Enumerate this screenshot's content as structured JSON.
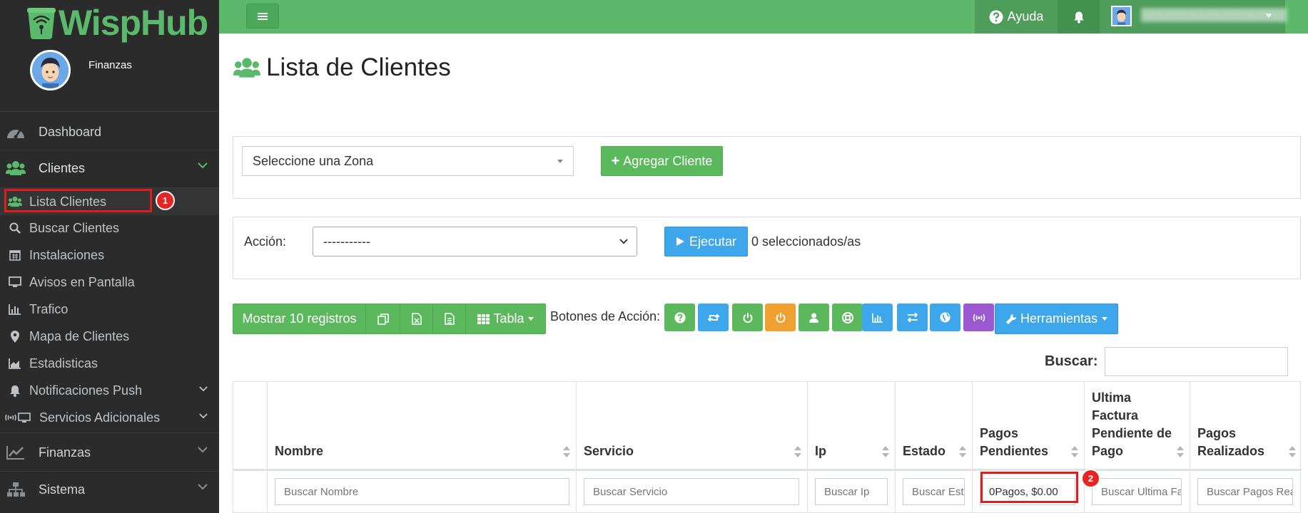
{
  "brand": {
    "name": "WispHub"
  },
  "user": {
    "role": "Finanzas"
  },
  "sidebar": {
    "main_items": [
      {
        "label": "Dashboard"
      },
      {
        "label": "Clientes"
      },
      {
        "label": "Finanzas"
      },
      {
        "label": "Sistema"
      }
    ],
    "clientes_sub": [
      {
        "label": "Lista Clientes"
      },
      {
        "label": "Buscar Clientes"
      },
      {
        "label": "Instalaciones"
      },
      {
        "label": "Avisos en Pantalla"
      },
      {
        "label": "Trafico"
      },
      {
        "label": "Mapa de Clientes"
      },
      {
        "label": "Estadisticas"
      },
      {
        "label": "Notificaciones Push"
      },
      {
        "label": "Servicios Adicionales"
      }
    ]
  },
  "annotations": {
    "marker1": "1",
    "marker2": "2"
  },
  "topbar": {
    "help_label": "Ayuda"
  },
  "page": {
    "title": "Lista de Clientes"
  },
  "zona": {
    "selected": "Seleccione una Zona"
  },
  "add_client": {
    "label": "Agregar Cliente"
  },
  "accion": {
    "label": "Acción:",
    "selected": "-----------",
    "execute_label": "Ejecutar",
    "selected_count": "0 seleccionados/as"
  },
  "toolbar": {
    "show_records": "Mostrar 10 registros",
    "view_label": "Tabla",
    "action_buttons_label": "Botones de Acción:",
    "tools_label": "Herramientas",
    "action_colors": [
      "#5cb85c",
      "#3ea6ea",
      "#5cb85c",
      "#f0a030",
      "#5cb85c",
      "#5cb85c",
      "#3ea6ea",
      "#3ea6ea",
      "#3ea6ea",
      "#9b59d0"
    ]
  },
  "search": {
    "label": "Buscar:"
  },
  "table": {
    "columns": [
      {
        "label": ""
      },
      {
        "label": "Nombre"
      },
      {
        "label": "Servicio"
      },
      {
        "label": "Ip"
      },
      {
        "label": "Estado"
      },
      {
        "label": "Pagos Pendientes"
      },
      {
        "label": "Ultima Factura Pendiente de Pago"
      },
      {
        "label": "Pagos Realizados"
      }
    ],
    "filters": [
      {
        "placeholder": "Buscar Nombre",
        "value": ""
      },
      {
        "placeholder": "Buscar Servicio",
        "value": ""
      },
      {
        "placeholder": "Buscar Ip",
        "value": ""
      },
      {
        "placeholder": "Buscar Estado",
        "value": ""
      },
      {
        "placeholder": "",
        "value": "0Pagos, $0.00"
      },
      {
        "placeholder": "Buscar Ultima Factura",
        "value": ""
      },
      {
        "placeholder": "Buscar Pagos Realizados",
        "value": ""
      }
    ]
  }
}
